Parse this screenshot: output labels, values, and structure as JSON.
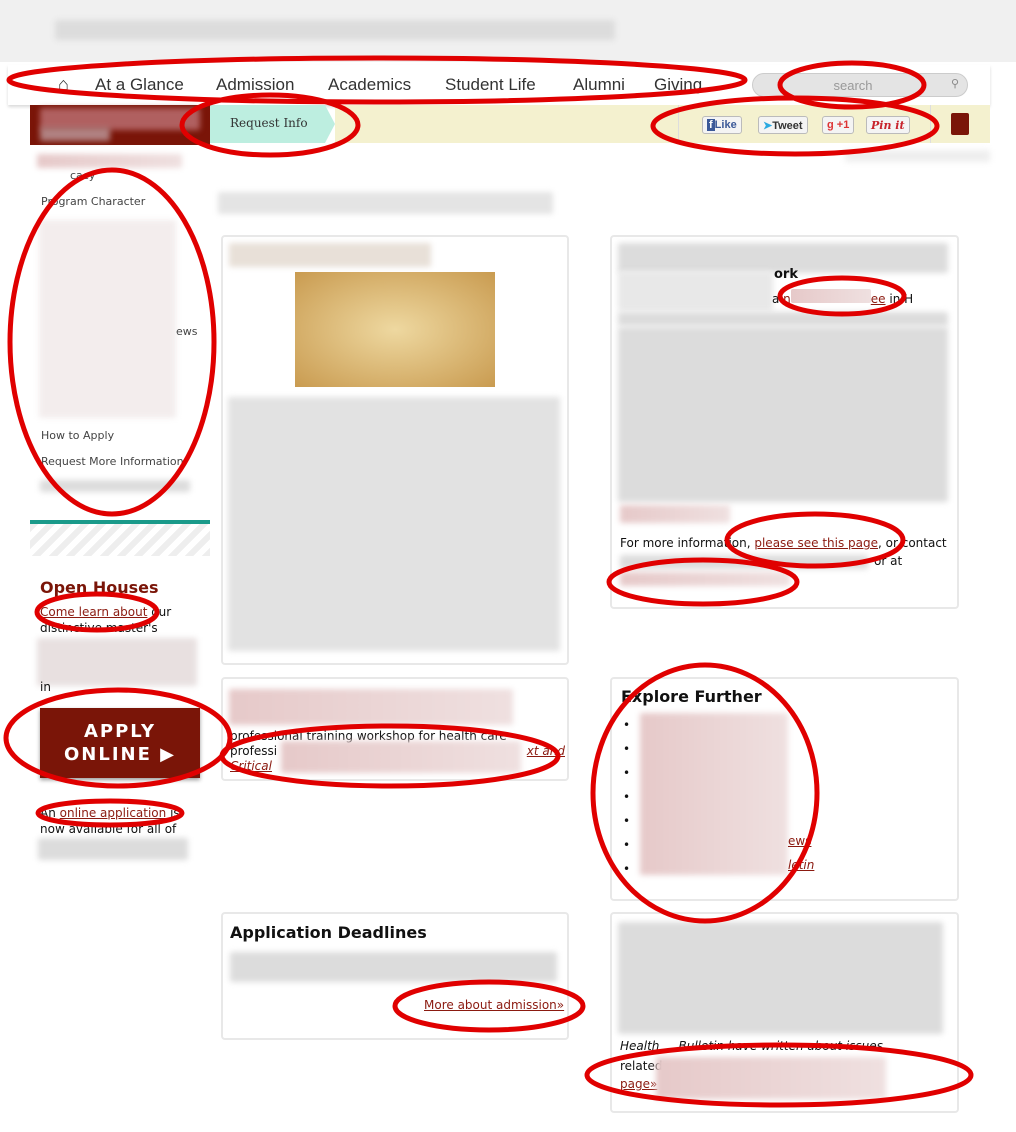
{
  "nav": {
    "items": [
      "At a Glance",
      "Admission",
      "Academics",
      "Student Life",
      "Alumni",
      "Giving"
    ],
    "search_placeholder": "search"
  },
  "subbar": {
    "request_info": "Request Info",
    "social": {
      "like": "Like",
      "tweet": "Tweet",
      "plus_one": "+1",
      "pin": "Pin it"
    }
  },
  "sidebar": {
    "partial_item": "cacy",
    "items": [
      "Program Character",
      "How to Apply",
      "Request More Information"
    ],
    "partial_ews": "ews",
    "open_houses": {
      "title": "Open Houses",
      "link": "Come learn about",
      "text1": " our",
      "text2": "distinctive master's",
      "text3": "in"
    },
    "apply": {
      "line1": "APPLY",
      "line2": "ONLINE"
    },
    "online": {
      "prefix": "An ",
      "link": "online application",
      "suffix": " is",
      "line2": "now available for all of"
    }
  },
  "card2": {
    "partial_heading": "ork",
    "frag_a": "a ",
    "link_start": "n",
    "link_end": "ee",
    "frag_in": " in H",
    "more_info": "For more information, ",
    "link": "please see this page",
    "after": ", or contact",
    "or_at": "or at"
  },
  "card3": {
    "line1": "professional training workshop for health care",
    "line2": "professi",
    "link_end": "xt and",
    "link2": "Critical "
  },
  "explore": {
    "title": "Explore Further",
    "partial1": "ews",
    "partial2": "letin"
  },
  "deadlines": {
    "title": "Application Deadlines",
    "more": "More about admission»"
  },
  "card6": {
    "italic": "Health ... Bulletin have written about issues",
    "related": "related",
    "page_link": "page»"
  },
  "colors": {
    "maroon": "#7a1508",
    "teal": "#1a9a8a",
    "link": "#8b1a10",
    "annotation": "#e00000"
  }
}
